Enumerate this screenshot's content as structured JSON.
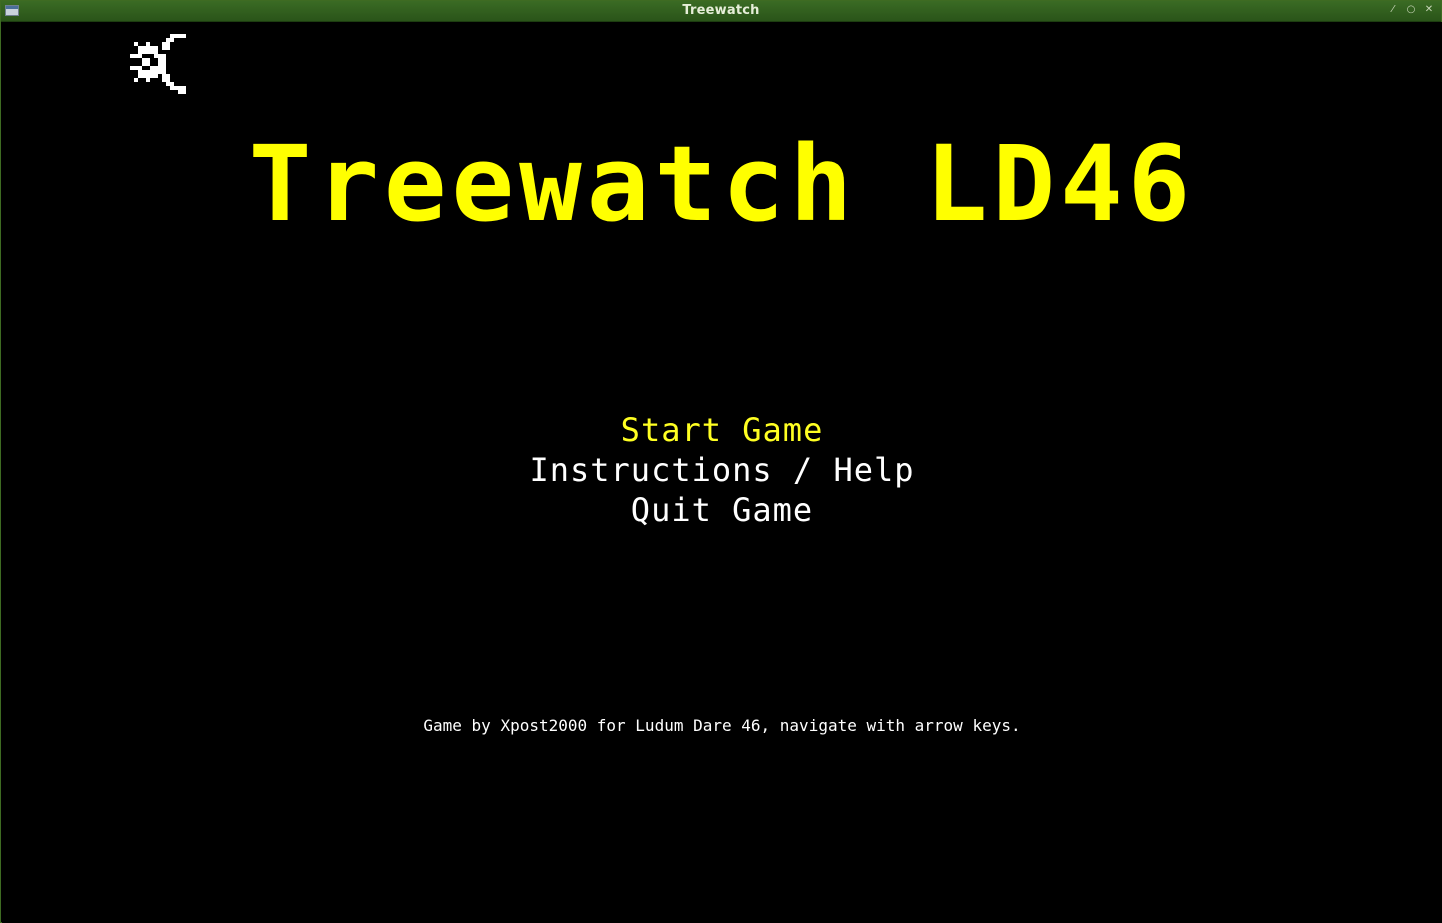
{
  "window": {
    "title": "Treewatch",
    "controls": [
      "⁄",
      "○",
      "✕"
    ]
  },
  "game": {
    "title": "Treewatch LD46",
    "menu": [
      {
        "label": "Start Game",
        "selected": true
      },
      {
        "label": "Instructions / Help",
        "selected": false
      },
      {
        "label": "Quit Game",
        "selected": false
      }
    ],
    "footer": "Game by Xpost2000 for Ludum Dare 46, navigate with arrow keys."
  },
  "colors": {
    "title": "#ffff00",
    "selected": "#ffff22",
    "menu_text": "#ffffff",
    "background": "#000000",
    "titlebar": "#2f5c1c"
  },
  "icons": {
    "app": "window-app-icon",
    "logo": "pixel-tree-logo-icon"
  }
}
